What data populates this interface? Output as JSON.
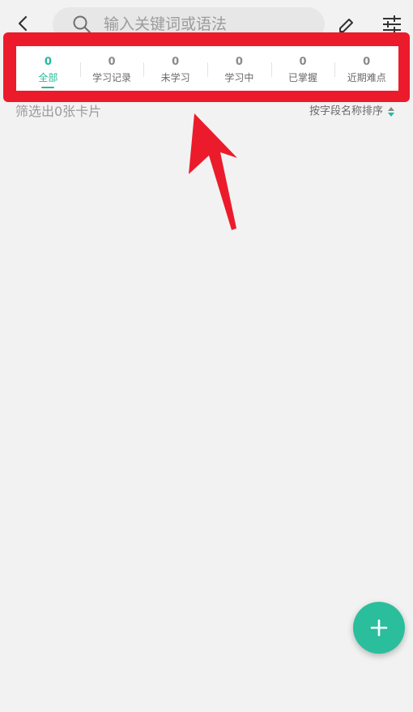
{
  "search": {
    "placeholder": "输入关键词或语法"
  },
  "tabs": [
    {
      "count": "0",
      "label": "全部",
      "active": true
    },
    {
      "count": "0",
      "label": "学习记录"
    },
    {
      "count": "0",
      "label": "未学习"
    },
    {
      "count": "0",
      "label": "学习中"
    },
    {
      "count": "0",
      "label": "已掌握"
    },
    {
      "count": "0",
      "label": "近期难点"
    }
  ],
  "result": {
    "count_text": "筛选出0张卡片"
  },
  "sort": {
    "label": "按字段名称排序"
  },
  "colors": {
    "accent": "#27b99a",
    "highlight": "#ec1b2b"
  }
}
